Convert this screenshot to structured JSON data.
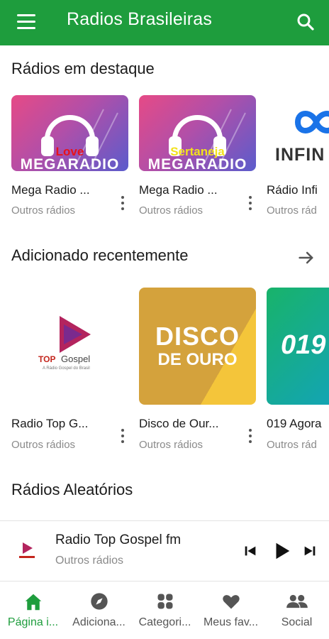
{
  "app": {
    "title": "Radios Brasileiras",
    "accent_color": "#1e9d3d"
  },
  "header": {
    "menu_icon": "hamburger-menu-icon",
    "search_icon": "search-icon"
  },
  "featured": {
    "title": "Rádios em destaque",
    "items": [
      {
        "name": "Mega Radio ...",
        "category": "Outros rádios",
        "badge": "Love",
        "brand": "MEGARADIO"
      },
      {
        "name": "Mega Radio ...",
        "category": "Outros rádios",
        "badge": "Sertaneja",
        "brand": "MEGARADIO"
      },
      {
        "name": "Rádio Infi",
        "category": "Outros rád",
        "brand": "INFIN"
      }
    ]
  },
  "recent": {
    "title": "Adicionado recentemente",
    "arrow_icon": "arrow-right-icon",
    "items": [
      {
        "name": "Radio Top G...",
        "category": "Outros rádios",
        "logo_main": "TOP",
        "logo_sub": "Gospel",
        "logo_tagline": "A Rádio Gospel do Brasil"
      },
      {
        "name": "Disco de Our...",
        "category": "Outros rádios",
        "logo_line1": "DISCO",
        "logo_line2": "DE OURO"
      },
      {
        "name": "019 Agora",
        "category": "Outros rád",
        "logo_text": "019"
      }
    ]
  },
  "random": {
    "title": "Rádios Aleatórios"
  },
  "player": {
    "title": "Radio Top Gospel fm",
    "category": "Outros rádios",
    "prev_icon": "skip-previous-icon",
    "play_icon": "play-icon",
    "next_icon": "skip-next-icon"
  },
  "bottom_nav": [
    {
      "label": "Página i...",
      "icon": "home-icon",
      "active": true
    },
    {
      "label": "Adiciona...",
      "icon": "compass-icon",
      "active": false
    },
    {
      "label": "Categori...",
      "icon": "grid-icon",
      "active": false
    },
    {
      "label": "Meus fav...",
      "icon": "heart-icon",
      "active": false
    },
    {
      "label": "Social",
      "icon": "people-icon",
      "active": false
    }
  ]
}
